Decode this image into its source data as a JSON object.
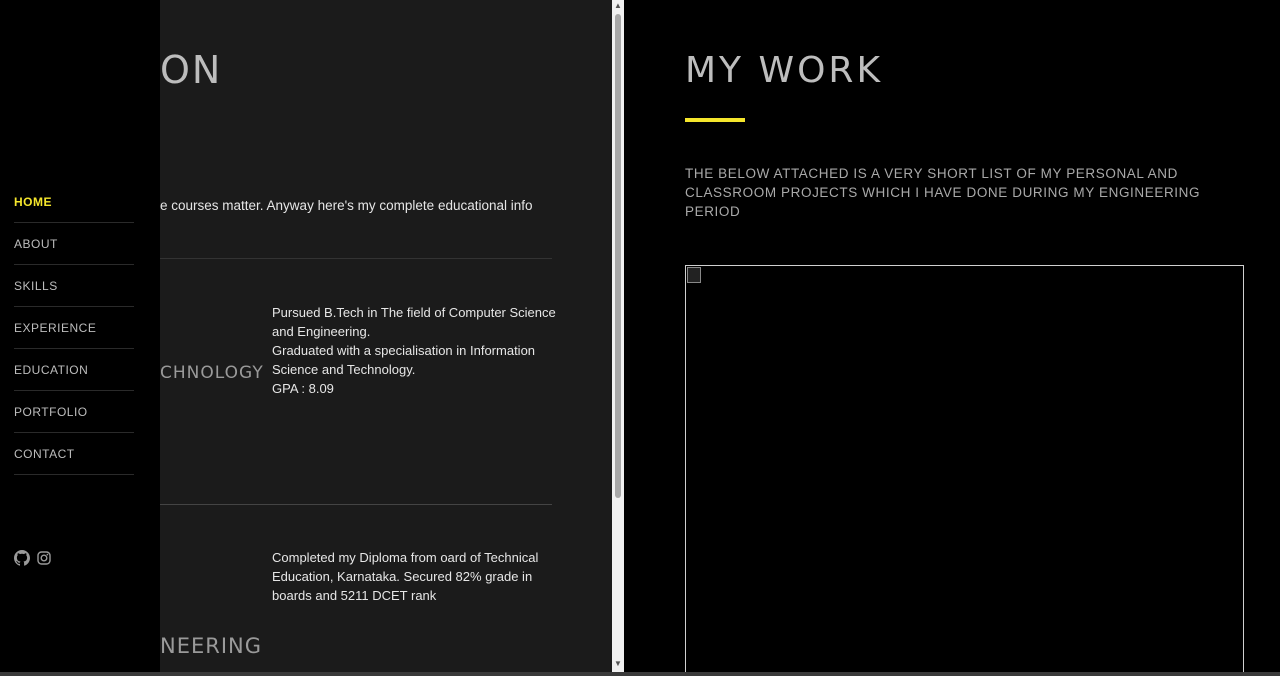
{
  "sidebar": {
    "items": [
      {
        "label": "HOME",
        "active": true
      },
      {
        "label": "ABOUT"
      },
      {
        "label": "SKILLS"
      },
      {
        "label": "EXPERIENCE"
      },
      {
        "label": "EDUCATION"
      },
      {
        "label": "PORTFOLIO"
      },
      {
        "label": "CONTACT"
      }
    ],
    "social": [
      "github-icon",
      "instagram-icon"
    ]
  },
  "education": {
    "title": "ON",
    "intro": "e courses matter. Anyway here's my complete educational info",
    "entries": [
      {
        "school": "CHNOLOGY",
        "lines": [
          "Pursued B.Tech in The field of Computer Science and Engineering.",
          "Graduated with a specialisation in Information Science and Technology.",
          "GPA : 8.09"
        ]
      },
      {
        "school": "NEERING",
        "lines": [
          "Completed my Diploma from oard of Technical Education, Karnataka. Secured 82% grade in boards and 5211 DCET rank"
        ]
      }
    ]
  },
  "work": {
    "title": "MY WORK",
    "description": "THE BELOW ATTACHED IS A VERY SHORT LIST OF MY PERSONAL AND CLASSROOM PROJECTS WHICH I HAVE DONE DURING MY ENGINEERING PERIOD"
  },
  "colors": {
    "accent": "#f5e62c",
    "background": "#000000",
    "panel": "#1b1b1b"
  }
}
